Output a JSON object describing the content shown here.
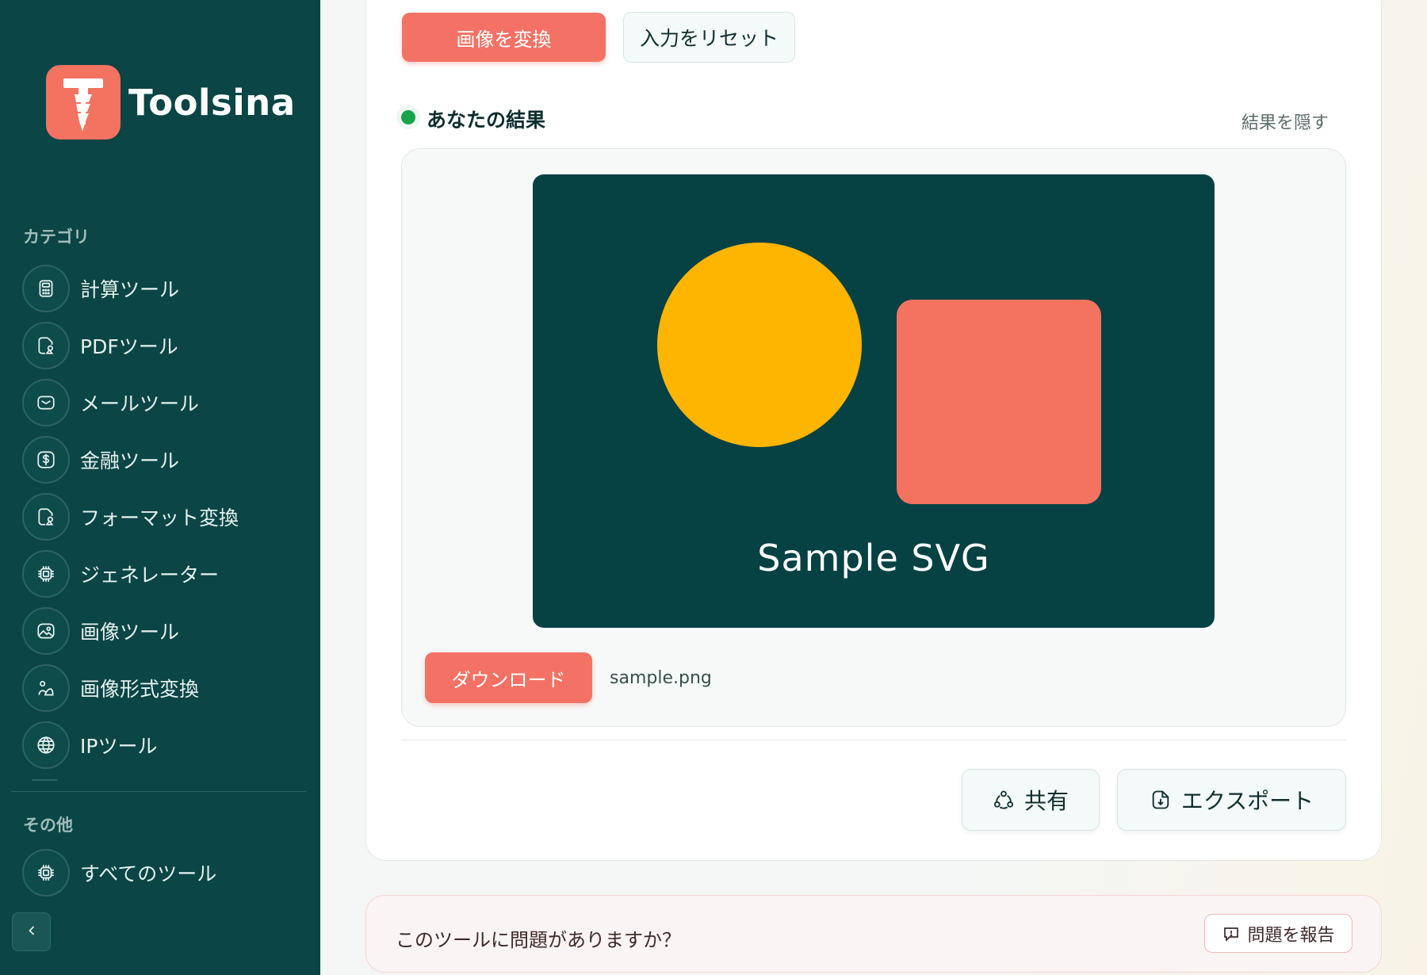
{
  "brand": {
    "name": "Toolsina",
    "accent": "#f47260",
    "sidebar_bg": "#0b4545"
  },
  "sidebar": {
    "categories_label": "カテゴリ",
    "items": [
      {
        "label": "計算ツール",
        "icon": "calculator-icon"
      },
      {
        "label": "PDFツール",
        "icon": "file-shapes-icon"
      },
      {
        "label": "メールツール",
        "icon": "mail-icon"
      },
      {
        "label": "金融ツール",
        "icon": "dollar-icon"
      },
      {
        "label": "フォーマット変換",
        "icon": "file-shapes-icon"
      },
      {
        "label": "ジェネレーター",
        "icon": "chip-icon"
      },
      {
        "label": "画像ツール",
        "icon": "image-icon"
      },
      {
        "label": "画像形式変換",
        "icon": "shapes-icon"
      },
      {
        "label": "IPツール",
        "icon": "globe-icon"
      }
    ],
    "other_label": "その他",
    "all_tools": {
      "label": "すべてのツール",
      "icon": "chip-icon"
    },
    "collapse_icon": "chevron-left-icon"
  },
  "actions": {
    "convert": "画像を変換",
    "reset": "入力をリセット"
  },
  "result": {
    "title": "あなたの結果",
    "hide": "結果を隠す",
    "preview_text": "Sample SVG",
    "download": "ダウンロード",
    "filename": "sample.png",
    "share": "共有",
    "export": "エクスポート",
    "colors": {
      "preview_bg": "#064144",
      "circle": "#fdb500",
      "square": "#f47260"
    }
  },
  "report": {
    "question": "このツールに問題がありますか？",
    "button": "問題を報告"
  }
}
